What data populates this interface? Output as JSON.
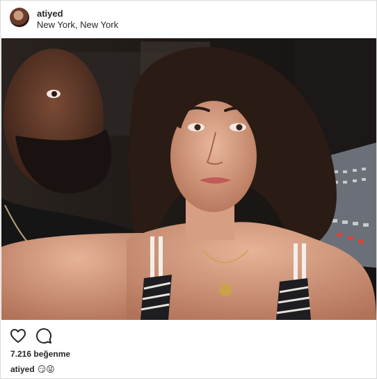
{
  "post": {
    "username": "atiyed",
    "location": "New York, New York",
    "likes_text": "7.216 beğenme",
    "caption": {
      "username": "atiyed",
      "emojis": "😏😜"
    }
  },
  "icons": {
    "like": "heart-icon",
    "comment": "comment-icon"
  },
  "colors": {
    "text": "#262626",
    "border": "#dbdbdb",
    "background": "#ffffff"
  }
}
